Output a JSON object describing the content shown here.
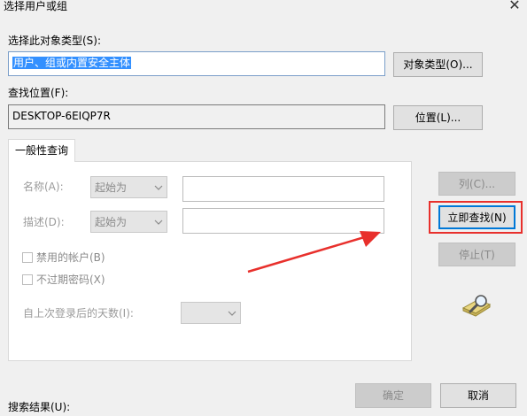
{
  "window": {
    "title": "选择用户或组",
    "close_glyph": "✕"
  },
  "object_types": {
    "label": "选择此对象类型(S):",
    "value": "用户、组或内置安全主体",
    "button": "对象类型(O)..."
  },
  "location": {
    "label": "查找位置(F):",
    "value": "DESKTOP-6EIQP7R",
    "button": "位置(L)..."
  },
  "tabs": [
    {
      "label": "一般性查询"
    }
  ],
  "query": {
    "name_label": "名称(A):",
    "name_mode": "起始为",
    "desc_label": "描述(D):",
    "desc_mode": "起始为",
    "disabled_accounts": "禁用的帐户(B)",
    "non_expiring": "不过期密码(X)",
    "days_label": "自上次登录后的天数(I):"
  },
  "side_buttons": {
    "columns": "列(C)...",
    "find_now": "立即查找(N)",
    "stop": "停止(T)"
  },
  "results": {
    "label": "搜索结果(U):"
  },
  "footer": {
    "ok": "确定",
    "cancel": "取消"
  },
  "colors": {
    "annotation_red": "#e8302c",
    "selection_blue": "#3390ff",
    "focus_blue": "#0078d7"
  },
  "icons": {
    "search_illustration": "magnifier-over-folder-icon",
    "chevron": "chevron-down-icon"
  }
}
